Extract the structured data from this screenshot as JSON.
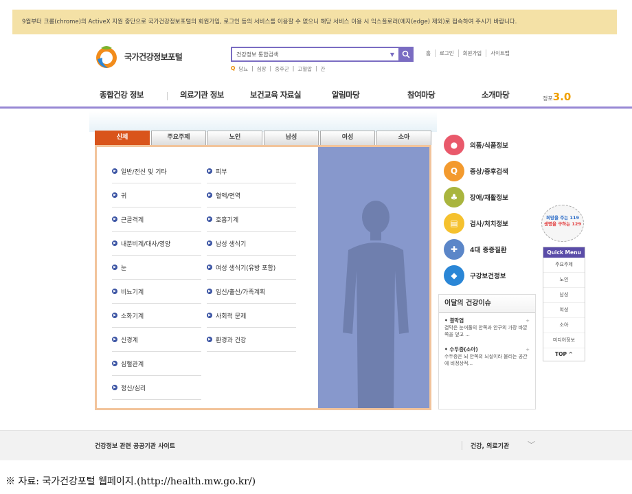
{
  "notice": "9월부터 크롬(chrome)의 ActiveX 지원 중단으로 국가건강정보포털의 회원가입, 로그인 등의 서비스를 이용할 수 없으니 해당 서비스 이용 시 익스플로러(에지(edge) 제외)로 접속하여 주시기 바랍니다.",
  "header": {
    "site_title": "국가건강정보포털",
    "search_placeholder": "건강정보 통합검색",
    "keywords": [
      "당뇨",
      "심장",
      "중후군",
      "고혈압",
      "간"
    ],
    "util_links": [
      "홈",
      "로그인",
      "회원가입",
      "사이트맵"
    ]
  },
  "gnb": [
    "종합건강 정보",
    "의료기관 정보",
    "보건교육 자료실",
    "알림마당",
    "참여마당",
    "소개마당"
  ],
  "version_label": {
    "prefix": "정포",
    "num": "3.0"
  },
  "tabs": [
    "신체",
    "주요주제",
    "노인",
    "남성",
    "여성",
    "소아"
  ],
  "list_col1": [
    "일반/전신 및 기타",
    "귀",
    "근골격계",
    "내분비계/대사/영양",
    "눈",
    "비뇨기계",
    "소화기계",
    "신경계",
    "심혈관계",
    "정신/심리"
  ],
  "list_col2": [
    "피부",
    "혈액/면역",
    "호흡기계",
    "남성 생식기",
    "여성 생식기(유방 포함)",
    "임신/출산/가족계획",
    "사회적 문제",
    "환경과 건강"
  ],
  "quick": [
    {
      "label": "의품/식품정보",
      "color": "#e9596b",
      "icon": "pill-icon"
    },
    {
      "label": "증상/증후검색",
      "color": "#f39a2e",
      "icon": "magnifier-icon"
    },
    {
      "label": "장애/재활정보",
      "color": "#a9b53e",
      "icon": "plant-icon"
    },
    {
      "label": "검사/처치정보",
      "color": "#f5c12e",
      "icon": "document-icon"
    },
    {
      "label": "4대 중증질환",
      "color": "#5b86c8",
      "icon": "syringe-icon"
    },
    {
      "label": "구강보건정보",
      "color": "#2a86d6",
      "icon": "tooth-icon"
    }
  ],
  "issue": {
    "title": "이달의 건강이슈",
    "items": [
      {
        "head": "결막염",
        "text": "결막은 눈꺼풀의 안쪽과 안구의 가장 바깥쪽을 덮고 ..."
      },
      {
        "head": "수두증(소아)",
        "text": "수두증은 뇌 안쪽의 뇌실이라 불리는 공간에 비정상적..."
      }
    ]
  },
  "badge": {
    "line1": "희망을 주는 119",
    "line2": "생명을 구하는 129"
  },
  "quick_menu": {
    "title": "Quick Menu",
    "items": [
      "주요주제",
      "노인",
      "남성",
      "여성",
      "소아",
      "미디어정보"
    ],
    "top": "TOP ^"
  },
  "footer": {
    "left": "건강정보 관련 공공기관 사이트",
    "right": "건강, 의료기관"
  },
  "source": "※ 자료: 국가건강포털 웹페이지.(http://health.mw.go.kr/)"
}
